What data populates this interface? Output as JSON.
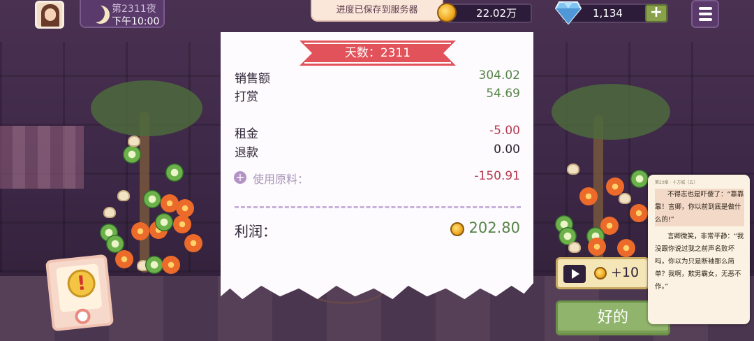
{
  "hud": {
    "day_title": "第2311夜",
    "time": "下午10:00",
    "saved_toast": "进度已保存到服务器",
    "coins": "22.02万",
    "gems": "1,134",
    "plus_label": "+"
  },
  "receipt": {
    "day_banner": "天数：2311",
    "rows": [
      {
        "label": "销售额",
        "value": "304.02"
      },
      {
        "label": "打赏",
        "value": "54.69"
      },
      {
        "label": "租金",
        "value": "-5.00"
      },
      {
        "label": "退款",
        "value": "0.00"
      }
    ],
    "materials_label": "使用原料：",
    "materials_value": "-150.91",
    "profit_label": "利润：",
    "profit_value": "202.80"
  },
  "ad": {
    "reward": "+10"
  },
  "ok_label": "好的",
  "alert_mark": "!",
  "novel": {
    "meta_left": "第20章 · 十方城（五）",
    "p1_a": "不得志也是吓傻了：“靠靠靠！言卿，你以前到底是做什么的!”",
    "p2": "言卿微笑，非常平静：“我没跟你说过我之前声名败坏吗，你以为只是断袖那么简单？我啊，欺男霸女，无恶不作。”"
  },
  "colors": {
    "positive": "#57844a",
    "negative": "#b63a52",
    "ribbon": "#e2525a",
    "ok_button": "#90b46b"
  }
}
